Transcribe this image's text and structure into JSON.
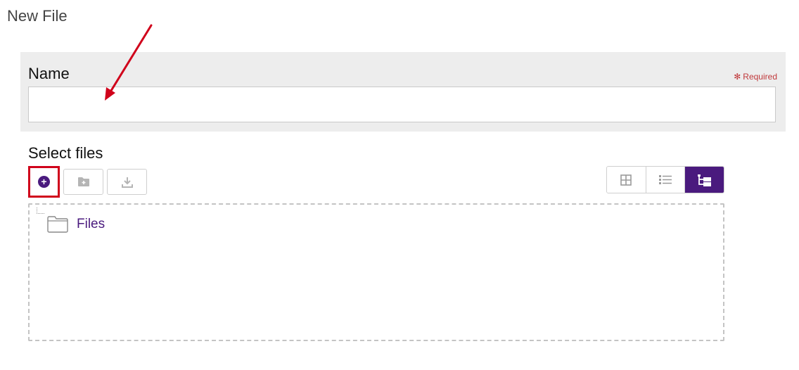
{
  "page": {
    "title": "New File"
  },
  "name_field": {
    "label": "Name",
    "required_text": "Required",
    "value": "",
    "placeholder": ""
  },
  "select_files": {
    "label": "Select files",
    "toolbar": {
      "add_icon": "plus-circle-icon",
      "new_folder_icon": "folder-plus-icon",
      "download_icon": "download-icon"
    },
    "views": [
      {
        "icon": "grid-view-icon",
        "active": false
      },
      {
        "icon": "list-view-icon",
        "active": false
      },
      {
        "icon": "tree-view-icon",
        "active": true
      }
    ],
    "tree": [
      {
        "label": "Files",
        "icon": "folder-icon"
      }
    ]
  },
  "colors": {
    "accent": "#4a1a7e",
    "required": "#c0393b",
    "highlight": "#d0021b",
    "annotation_arrow": "#d0021b"
  }
}
